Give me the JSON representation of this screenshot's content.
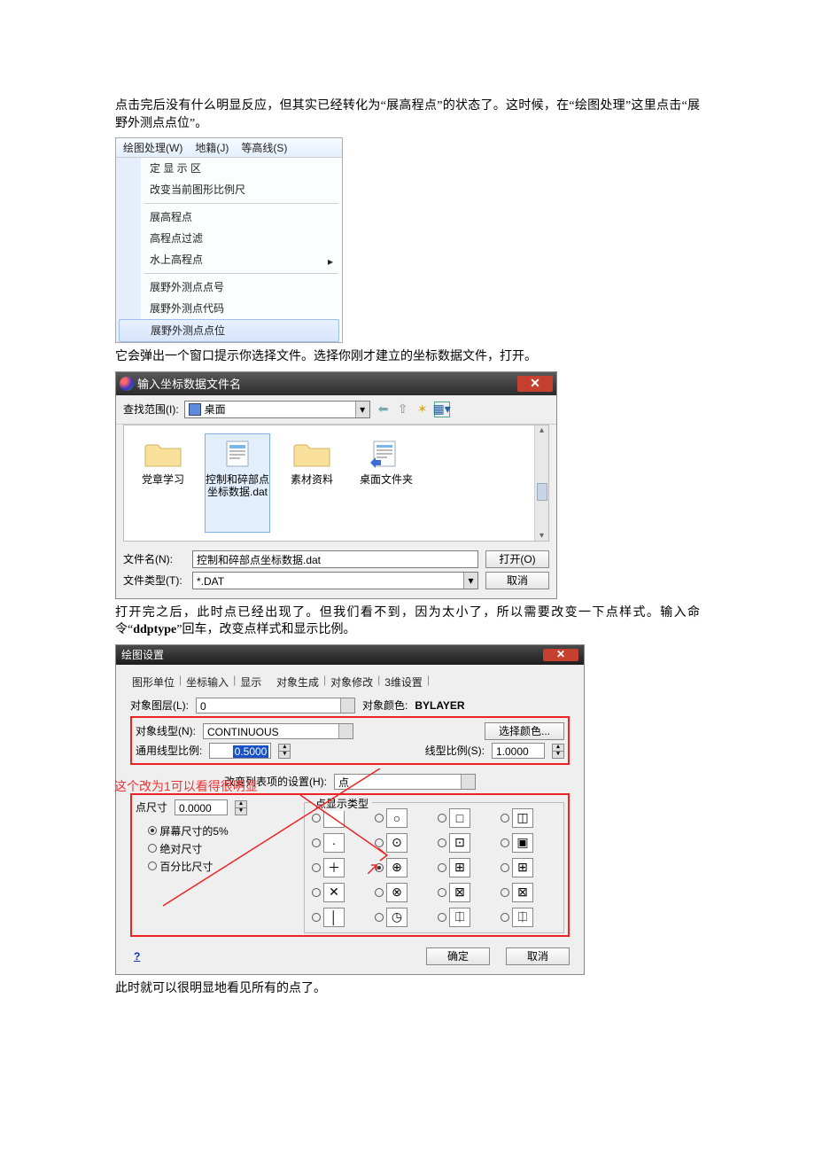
{
  "para1": "点击完后没有什么明显反应，但其实已经转化为“展高程点”的状态了。这时候，在“绘图处理”这里点击“展野外测点点位”。",
  "menu": {
    "bar": {
      "drawing": "绘图处理(W)",
      "cadastre": "地籍(J)",
      "contour": "等高线(S)"
    },
    "items": {
      "set_area": "定 显 示 区",
      "change_scale": "改变当前图形比例尺",
      "elev_pt": "展高程点",
      "elev_filter": "高程点过滤",
      "water_elev": "水上高程点",
      "field_num": "展野外测点点号",
      "field_code": "展野外测点代码",
      "field_pos": "展野外测点点位"
    }
  },
  "para2": "它会弹出一个窗口提示你选择文件。选择你刚才建立的坐标数据文件，打开。",
  "filedlg": {
    "title": "输入坐标数据文件名",
    "look_label": "查找范围(I):",
    "look_value": "桌面",
    "files": {
      "f1": "党章学习",
      "f2": "控制和碎部点坐标数据.dat",
      "f3": "素材资料",
      "f4": "桌面文件夹"
    },
    "fname_label": "文件名(N):",
    "fname_value": "控制和碎部点坐标数据.dat",
    "ftype_label": "文件类型(T):",
    "ftype_value": "*.DAT",
    "open_btn": "打开(O)",
    "cancel_btn": "取消"
  },
  "para3a": "打开完之后，此时点已经出现了。但我们看不到，因为太小了，所以需要改变一下点样式。输入命令“",
  "para3cmd": "ddptype",
  "para3b": "”回车，改变点样式和显示比例。",
  "settings": {
    "title": "绘图设置",
    "tabs": {
      "t1": "图形单位",
      "t2": "坐标输入",
      "t3": "显示",
      "t4": "对象生成",
      "t5": "对象修改",
      "t6": "3维设置"
    },
    "obj_layer_label": "对象图层(L):",
    "obj_layer_value": "0",
    "obj_color_label": "对象颜色:",
    "obj_color_value": "BYLAYER",
    "obj_ltype_label": "对象线型(N):",
    "obj_ltype_value": "CONTINUOUS",
    "pick_color": "选择颜色...",
    "global_scale_label": "通用线型比例:",
    "global_scale_value": "0.5000",
    "ltscale_label": "线型比例(S):",
    "ltscale_value": "1.0000",
    "anno": "这个改为1可以看得很明显",
    "change_list_label": "改变列表项的设置(H):",
    "change_list_value": "点",
    "point_size_label": "点尺寸",
    "point_size_value": "0.0000",
    "size_opts": {
      "o1": "屏幕尺寸的5%",
      "o2": "绝对尺寸",
      "o3": "百分比尺寸"
    },
    "ptype_legend": "点显示类型",
    "help": "?",
    "ok": "确定",
    "cancel": "取消"
  },
  "para4": "此时就可以很明显地看见所有的点了。"
}
